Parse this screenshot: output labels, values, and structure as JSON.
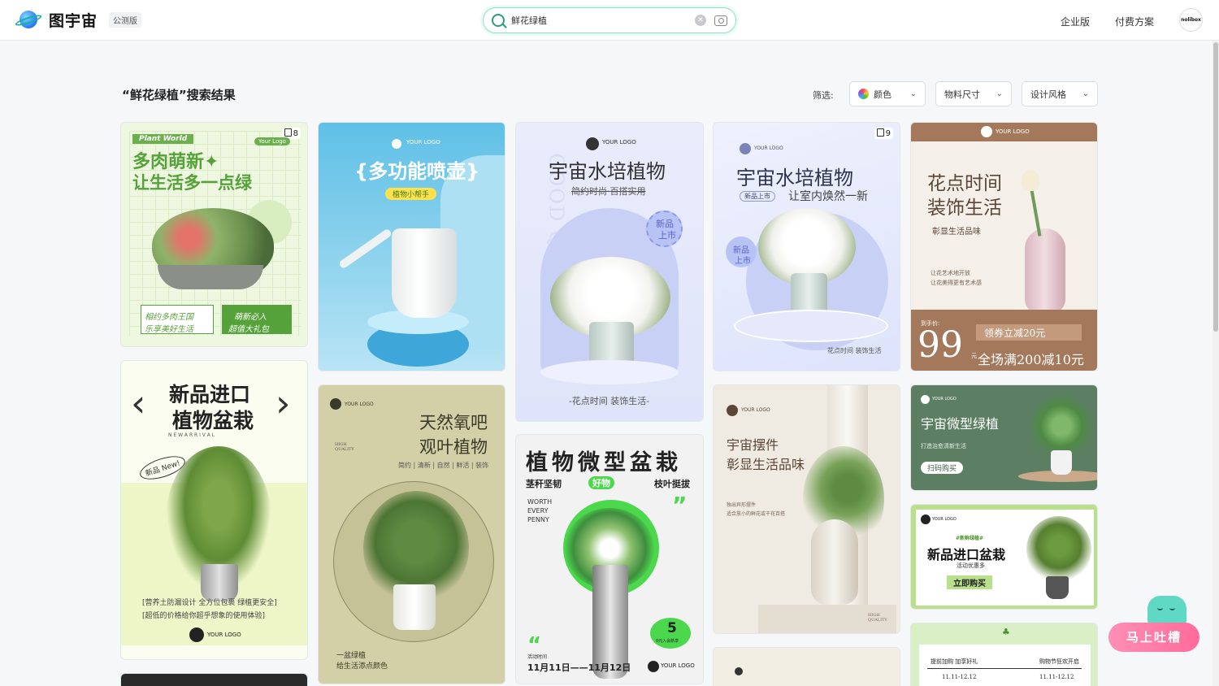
{
  "header": {
    "brand": "图宇宙",
    "beta_badge": "公测版",
    "search_value": "鲜花绿植",
    "nav_enterprise": "企业版",
    "nav_pricing": "付费方案",
    "avatar_text": "nolibox"
  },
  "results": {
    "title": "“鲜花绿植”搜索结果",
    "filter_label": "筛选:",
    "filters": [
      "颜色",
      "物料尺寸",
      "设计风格"
    ]
  },
  "cards": {
    "c1": {
      "count": "8",
      "tag": "Plant World",
      "logo": "Your Logo",
      "title1": "多肉萌新✦",
      "title2": "让生活多一点绿",
      "left1": "相约多肉王国",
      "left2": "乐享美好生活",
      "right1": "萌新必入",
      "right2": "超值大礼包"
    },
    "c2": {
      "logo": "YOUR LOGO",
      "title": "{多功能喷壶}",
      "badge": "植物小帮手"
    },
    "c3": {
      "logo": "YOUR LOGO",
      "title": "宇宙水培植物",
      "sub": "简约时尚·百搭实用",
      "badge1": "新品",
      "badge2": "上市",
      "side": "GOOD QUALITY",
      "bottom": "-花点时间 装饰生活-"
    },
    "c4": {
      "count": "9",
      "logo": "YOUR LOGO",
      "title": "宇宙水培植物",
      "tag": "新品上市",
      "sub": "让室内焕然一新",
      "badge1": "新品",
      "badge2": "上市",
      "bottom": "花点时间 装饰生活"
    },
    "c5": {
      "logo": "YOUR LOGO",
      "title1": "花点时间",
      "title2": "装饰生活",
      "sub": "彰显生活品味",
      "desc1": "让花艺术地开放",
      "desc2": "让花美得更有艺术感",
      "price_label": "到手价:",
      "price": "99",
      "unit": "元",
      "coupon": "领券立减20元",
      "promo": "全场满200减10元"
    },
    "c6": {
      "title1": "新品进口",
      "title2": "植物盆栽",
      "en": "N E W   A R R I V A L",
      "badge": "新品 New!",
      "line1": "[营养土防漏设计 全方位包裹 绿植更安全]",
      "line2": "[超低的价格给你超乎想象的使用体验]",
      "logo": "YOUR LOGO"
    },
    "c7": {
      "logo": "YOUR LOGO",
      "title1": "天然氧吧",
      "title2": "观叶植物",
      "tags": "简约 | 清新 | 自然 | 鲜活 | 装饰",
      "small": "HIGH QUALITY",
      "foot1": "一盆绿植",
      "foot2": "给生活添点颜色"
    },
    "c8": {
      "title": "植物微型盆栽",
      "left": "茎秆坚韧",
      "mid": "好物",
      "right": "枝叶挺拔",
      "en1": "WORTH",
      "en2": "EVERY",
      "en3": "PENNY",
      "price": "5",
      "price_note": "0元入会新享",
      "date_label": "活动时间",
      "date": "11月11日——11月12日",
      "logo": "YOUR LOGO"
    },
    "c9": {
      "logo": "YOUR LOGO",
      "title1": "宇宙摆件",
      "title2": "彰显生活品味",
      "desc1": "独出异形摆件",
      "desc2": "适合放小的鲜花或干花百搭",
      "foot": "HIGH QUALITY"
    },
    "c10": {
      "logo": "YOUR LOGO",
      "title": "宇宙微型绿植",
      "sub": "打造治愈清新生活",
      "btn": "扫码购买"
    },
    "c11": {
      "logo": "YOUR LOGO",
      "tag": "#新鲜绿植#",
      "title": "新品进口盆栽",
      "sub": "活动优惠多",
      "btn": "立即购买"
    },
    "c12": {
      "left": "提前加购 加享好礼",
      "right": "购物节狂欢开启",
      "d1": "11.11-12.12",
      "d2": "11.11-12.12"
    }
  },
  "feedback": {
    "label": "马上吐槽"
  },
  "colors": {
    "accent": "#2d9b7c",
    "feedback": "#ff6b9b"
  }
}
